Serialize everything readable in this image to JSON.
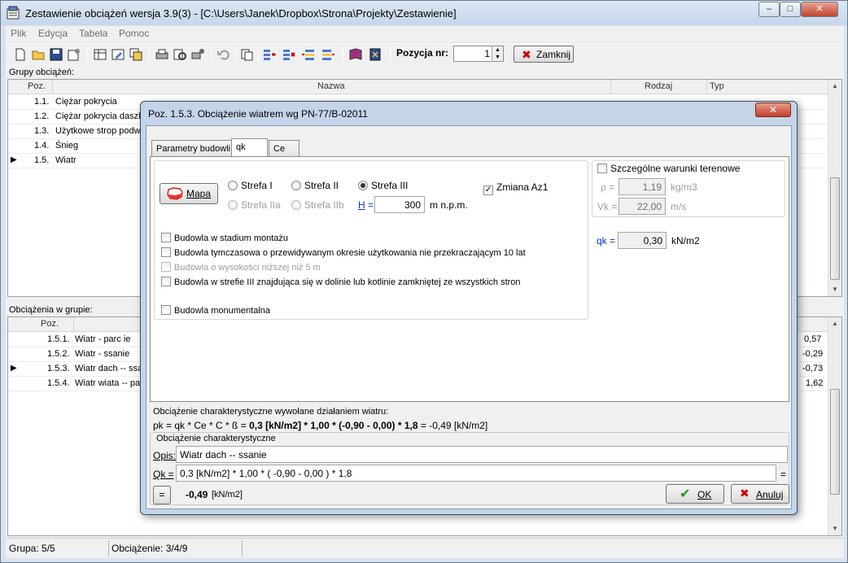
{
  "window": {
    "title": "Zestawienie obciążeń wersja 3.9(3) - [C:\\Users\\Janek\\Dropbox\\Strona\\Projekty\\Zestawienie]",
    "min_glyph": "–",
    "max_glyph": "□",
    "close_glyph": "✕"
  },
  "menu": [
    "Plik",
    "Edycja",
    "Tabela",
    "Pomoc"
  ],
  "toolbar": {
    "position_label": "Pozycja nr:",
    "position_value": "1",
    "close_label": "Zamknij"
  },
  "groups": {
    "label": "Grupy obciążeń:",
    "columns": [
      "Poz.",
      "Nazwa",
      "Rodzaj",
      "Typ"
    ],
    "rows": [
      {
        "pos": "1.1.",
        "name": "Ciężar pokrycia",
        "marker": ""
      },
      {
        "pos": "1.2.",
        "name": "Ciężar pokrycia daszku",
        "marker": ""
      },
      {
        "pos": "1.3.",
        "name": "Użytkowe strop podwie",
        "marker": ""
      },
      {
        "pos": "1.4.",
        "name": "Śnieg",
        "marker": ""
      },
      {
        "pos": "1.5.",
        "name": "Wiatr",
        "marker": "▶"
      }
    ]
  },
  "loads": {
    "label": "Obciążenia w grupie:",
    "columns": [
      "Poz."
    ],
    "rows": [
      {
        "pos": "1.5.1.",
        "name": "Wiatr - parc ie",
        "value": "0,57",
        "marker": ""
      },
      {
        "pos": "1.5.2.",
        "name": "Wiatr - ssanie",
        "value": "-0,29",
        "marker": ""
      },
      {
        "pos": "1.5.3.",
        "name": "Wiatr dach -- ssa",
        "value": "-0,73",
        "marker": "▶"
      },
      {
        "pos": "1.5.4.",
        "name": "Wiatr wiata -- parc",
        "value": "1,62",
        "marker": ""
      }
    ]
  },
  "status": {
    "group": "Grupa: 5/5",
    "load": "Obciążenie: 3/4/9"
  },
  "dialog": {
    "title": "Poz. 1.5.3. Obciążenie wiatrem wg PN-77/B-02011",
    "close_glyph": "✕",
    "tabs": [
      "Parametry budowli",
      "qk",
      "Ce"
    ],
    "active_tab": "qk",
    "map_button": "Mapa",
    "zones": {
      "strefa_i": "Strefa I",
      "strefa_ii": "Strefa II",
      "strefa_iii": "Strefa III",
      "strefa_iia": "Strefa IIa",
      "strefa_iib": "Strefa IIb",
      "selected": "Strefa III"
    },
    "zmiana_az1": {
      "label": "Zmiana Az1",
      "checked": true
    },
    "height": {
      "label": "H",
      "eq": "=",
      "value": "300",
      "unit": "m n.p.m."
    },
    "checkboxes": [
      {
        "label": "Budowla w stadium montażu",
        "checked": false,
        "disabled": false
      },
      {
        "label": "Budowla tymczasowa o przewidywanym okresie użytkowania nie przekraczającym 10 lat",
        "checked": false,
        "disabled": false
      },
      {
        "label": "Budowla o wysokości niższej niż 5 m",
        "checked": false,
        "disabled": true
      },
      {
        "label": "Budowla w strefie III znajdująca się w dolinie lub kotlinie zamkniętej ze wszystkich stron",
        "checked": false,
        "disabled": false
      },
      {
        "label": "Budowla monumentalna",
        "checked": false,
        "disabled": false
      }
    ],
    "special_terrain": {
      "label": "Szczególne warunki terenowe",
      "checked": false,
      "rho_label": "ρ =",
      "rho_value": "1,19",
      "rho_unit": "kg/m3",
      "vk_label": "Vk =",
      "vk_value": "22,00",
      "vk_unit": "m/s"
    },
    "qk": {
      "label": "qk =",
      "value": "0,30",
      "unit": "kN/m2"
    },
    "char_title": "Obciążenie charakterystyczne wywołane działaniem wiatru:",
    "formula_prefix": "pk = qk * Ce * C * ß =",
    "formula_bold": "0,3 [kN/m2] * 1,00 * (-0,90 - 0,00) * 1,8",
    "formula_result": "= -0,49 [kN/m2]",
    "char_group": "Obciążenie charakterystyczne",
    "opis_label": "Opis:",
    "opis_value": "Wiatr dach -- ssanie",
    "qk_label": "Qk =",
    "qk_value": "0,3 [kN/m2] * 1,00 * ( -0,90 - 0,00 ) * 1,8",
    "qk_eq": "=",
    "eq_button": "=",
    "result_value": "-0,49",
    "result_unit": "[kN/m2]",
    "ok_label": "OK",
    "cancel_label": "Anuluj"
  }
}
